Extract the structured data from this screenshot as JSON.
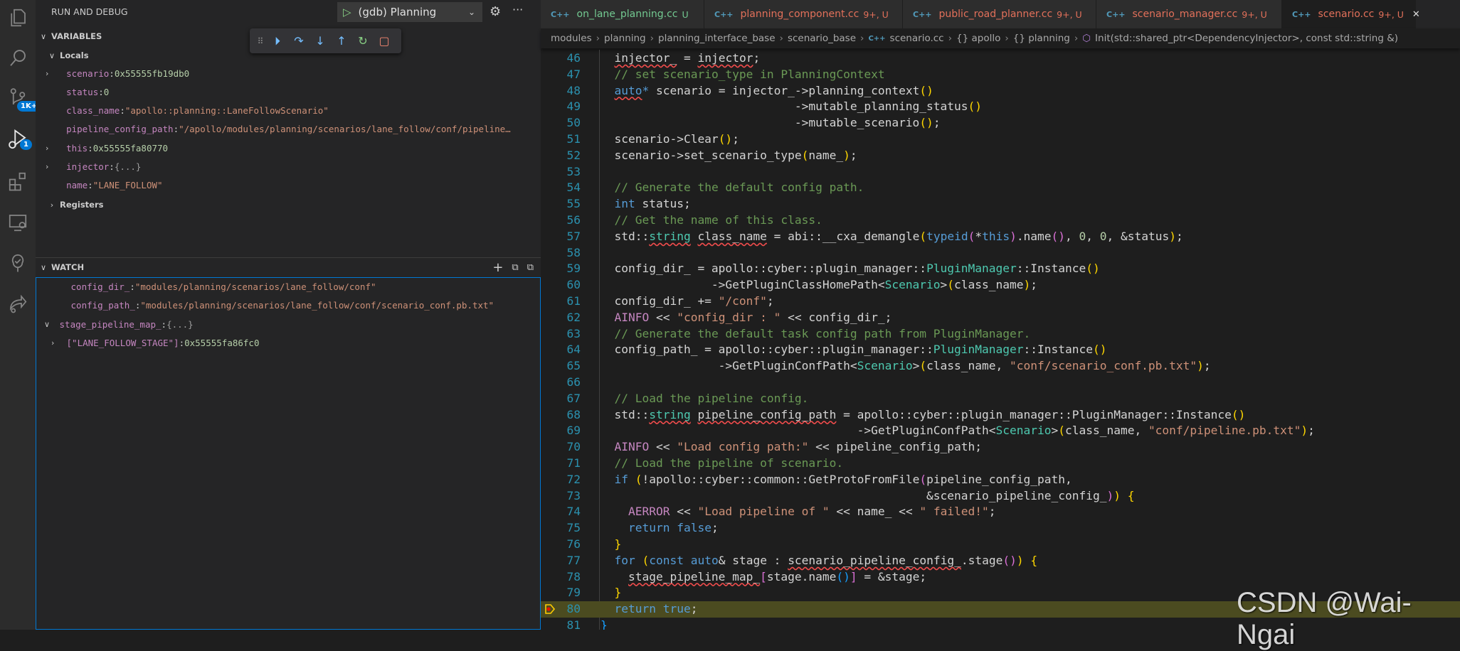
{
  "sidebar": {
    "title": "RUN AND DEBUG",
    "launch_config": "(gdb) Planning",
    "variables_header": "VARIABLES",
    "locals_label": "Locals",
    "locals": [
      {
        "name": "scenario",
        "value": "0x55555fb19db0",
        "kind": "hex",
        "expandable": true
      },
      {
        "name": "status",
        "value": "0",
        "kind": "hex",
        "expandable": false
      },
      {
        "name": "class_name",
        "value": "\"apollo::planning::LaneFollowScenario\"",
        "kind": "str",
        "expandable": false
      },
      {
        "name": "pipeline_config_path",
        "value": "\"/apollo/modules/planning/scenarios/lane_follow/conf/pipeline…",
        "kind": "str",
        "expandable": false
      },
      {
        "name": "this",
        "value": "0x55555fa80770",
        "kind": "hex",
        "expandable": true
      },
      {
        "name": "injector",
        "value": "{...}",
        "kind": "obj",
        "expandable": true
      },
      {
        "name": "name",
        "value": "\"LANE_FOLLOW\"",
        "kind": "str",
        "expandable": false
      }
    ],
    "registers_label": "Registers",
    "watch_header": "WATCH",
    "watch": [
      {
        "name": "config_dir_",
        "value": "\"modules/planning/scenarios/lane_follow/conf\"",
        "kind": "str",
        "indent": 1,
        "twisty": ""
      },
      {
        "name": "config_path_",
        "value": "\"modules/planning/scenarios/lane_follow/conf/scenario_conf.pb.txt\"",
        "kind": "str",
        "indent": 1,
        "twisty": ""
      },
      {
        "name": "stage_pipeline_map_",
        "value": "{...}",
        "kind": "obj",
        "indent": 0,
        "twisty": "expanded"
      },
      {
        "name": "[\"LANE_FOLLOW_STAGE\"]",
        "value": "0x55555fa86fc0",
        "kind": "hex",
        "indent": 2,
        "twisty": "collapsed"
      }
    ]
  },
  "activity_badges": {
    "scm": "1K+",
    "debug": "1"
  },
  "tabs": [
    {
      "label": "on_lane_planning.cc",
      "status": "U",
      "color": "#73c991",
      "active": false
    },
    {
      "label": "planning_component.cc",
      "status": "9+, U",
      "color": "#e2705a",
      "active": false
    },
    {
      "label": "public_road_planner.cc",
      "status": "9+, U",
      "color": "#e2705a",
      "active": false
    },
    {
      "label": "scenario_manager.cc",
      "status": "9+, U",
      "color": "#e2705a",
      "active": false
    },
    {
      "label": "scenario.cc",
      "status": "9+, U",
      "color": "#e2705a",
      "active": true
    }
  ],
  "tab_icon": "C++",
  "breadcrumbs": [
    "modules",
    "planning",
    "planning_interface_base",
    "scenario_base",
    "scenario.cc",
    "{} apollo",
    "{} planning",
    "Init(std::shared_ptr<DependencyInjector>, const std::string &)"
  ],
  "current_line": 80,
  "code_lines": [
    {
      "n": 46,
      "t": [
        [
          "o",
          "  "
        ],
        [
          "oe",
          "injector_"
        ],
        [
          "o",
          " = "
        ],
        [
          "oe",
          "injector"
        ],
        [
          "o",
          ";"
        ]
      ]
    },
    {
      "n": 47,
      "t": [
        [
          "o",
          "  "
        ],
        [
          "c",
          "// set scenario_type in PlanningContext"
        ]
      ]
    },
    {
      "n": 48,
      "t": [
        [
          "o",
          "  "
        ],
        [
          "ke",
          "auto"
        ],
        [
          "k",
          "*"
        ],
        [
          "o",
          " scenario = injector_->planning_context"
        ],
        [
          "p",
          "()"
        ]
      ]
    },
    {
      "n": 49,
      "t": [
        [
          "o",
          "                            ->mutable_planning_status"
        ],
        [
          "p",
          "()"
        ]
      ]
    },
    {
      "n": 50,
      "t": [
        [
          "o",
          "                            ->mutable_scenario"
        ],
        [
          "p",
          "()"
        ],
        [
          "o",
          ";"
        ]
      ]
    },
    {
      "n": 51,
      "t": [
        [
          "o",
          "  scenario->Clear"
        ],
        [
          "p",
          "()"
        ],
        [
          "o",
          ";"
        ]
      ]
    },
    {
      "n": 52,
      "t": [
        [
          "o",
          "  scenario->set_scenario_type"
        ],
        [
          "p",
          "("
        ],
        [
          "o",
          "name_"
        ],
        [
          "p",
          ")"
        ],
        [
          "o",
          ";"
        ]
      ]
    },
    {
      "n": 53,
      "t": []
    },
    {
      "n": 54,
      "t": [
        [
          "o",
          "  "
        ],
        [
          "c",
          "// Generate the default config path."
        ]
      ]
    },
    {
      "n": 55,
      "t": [
        [
          "o",
          "  "
        ],
        [
          "k",
          "int"
        ],
        [
          "o",
          " status;"
        ]
      ]
    },
    {
      "n": 56,
      "t": [
        [
          "o",
          "  "
        ],
        [
          "c",
          "// Get the name of this class."
        ]
      ]
    },
    {
      "n": 57,
      "t": [
        [
          "o",
          "  std::"
        ],
        [
          "te",
          "string"
        ],
        [
          "o",
          " "
        ],
        [
          "oe",
          "class_name"
        ],
        [
          "o",
          " = abi::__cxa_demangle"
        ],
        [
          "p",
          "("
        ],
        [
          "k",
          "typeid"
        ],
        [
          "p2",
          "("
        ],
        [
          "o",
          "*"
        ],
        [
          "k",
          "this"
        ],
        [
          "p2",
          ")"
        ],
        [
          "o",
          ".name"
        ],
        [
          "p2",
          "()"
        ],
        [
          "o",
          ", "
        ],
        [
          "n",
          "0"
        ],
        [
          "o",
          ", "
        ],
        [
          "n",
          "0"
        ],
        [
          "o",
          ", &status"
        ],
        [
          "p",
          ")"
        ],
        [
          "o",
          ";"
        ]
      ]
    },
    {
      "n": 58,
      "t": []
    },
    {
      "n": 59,
      "t": [
        [
          "o",
          "  config_dir_ = apollo::cyber::plugin_manager::"
        ],
        [
          "t",
          "PluginManager"
        ],
        [
          "o",
          "::Instance"
        ],
        [
          "p",
          "()"
        ]
      ]
    },
    {
      "n": 60,
      "t": [
        [
          "o",
          "                ->GetPluginClassHomePath<"
        ],
        [
          "t",
          "Scenario"
        ],
        [
          "o",
          ">"
        ],
        [
          "p",
          "("
        ],
        [
          "o",
          "class_name"
        ],
        [
          "p",
          ")"
        ],
        [
          "o",
          ";"
        ]
      ]
    },
    {
      "n": 61,
      "t": [
        [
          "o",
          "  config_dir_ += "
        ],
        [
          "s",
          "\"/conf\""
        ],
        [
          "o",
          ";"
        ]
      ]
    },
    {
      "n": 62,
      "t": [
        [
          "o",
          "  "
        ],
        [
          "m",
          "AINFO"
        ],
        [
          "o",
          " << "
        ],
        [
          "s",
          "\"config_dir : \""
        ],
        [
          "o",
          " << config_dir_;"
        ]
      ]
    },
    {
      "n": 63,
      "t": [
        [
          "o",
          "  "
        ],
        [
          "c",
          "// Generate the default task config path from PluginManager."
        ]
      ]
    },
    {
      "n": 64,
      "t": [
        [
          "o",
          "  config_path_ = apollo::cyber::plugin_manager::"
        ],
        [
          "t",
          "PluginManager"
        ],
        [
          "o",
          "::Instance"
        ],
        [
          "p",
          "()"
        ]
      ]
    },
    {
      "n": 65,
      "t": [
        [
          "o",
          "                 ->GetPluginConfPath<"
        ],
        [
          "t",
          "Scenario"
        ],
        [
          "o",
          ">"
        ],
        [
          "p",
          "("
        ],
        [
          "o",
          "class_name, "
        ],
        [
          "s",
          "\"conf/scenario_conf.pb.txt\""
        ],
        [
          "p",
          ")"
        ],
        [
          "o",
          ";"
        ]
      ]
    },
    {
      "n": 66,
      "t": []
    },
    {
      "n": 67,
      "t": [
        [
          "o",
          "  "
        ],
        [
          "c",
          "// Load the pipeline config."
        ]
      ]
    },
    {
      "n": 68,
      "t": [
        [
          "o",
          "  std::"
        ],
        [
          "te",
          "string"
        ],
        [
          "o",
          " "
        ],
        [
          "oe",
          "pipeline_config_path"
        ],
        [
          "o",
          " = apollo::cyber::plugin_manager::PluginManager::Instance"
        ],
        [
          "p",
          "()"
        ]
      ]
    },
    {
      "n": 69,
      "t": [
        [
          "o",
          "                                     ->GetPluginConfPath<"
        ],
        [
          "t",
          "Scenario"
        ],
        [
          "o",
          ">"
        ],
        [
          "p",
          "("
        ],
        [
          "o",
          "class_name, "
        ],
        [
          "s",
          "\"conf/pipeline.pb.txt\""
        ],
        [
          "p",
          ")"
        ],
        [
          "o",
          ";"
        ]
      ]
    },
    {
      "n": 70,
      "t": [
        [
          "o",
          "  "
        ],
        [
          "m",
          "AINFO"
        ],
        [
          "o",
          " << "
        ],
        [
          "s",
          "\"Load config path:\""
        ],
        [
          "o",
          " << pipeline_config_path;"
        ]
      ]
    },
    {
      "n": 71,
      "t": [
        [
          "o",
          "  "
        ],
        [
          "c",
          "// Load the pipeline of scenario."
        ]
      ]
    },
    {
      "n": 72,
      "t": [
        [
          "o",
          "  "
        ],
        [
          "k",
          "if"
        ],
        [
          "o",
          " "
        ],
        [
          "p",
          "("
        ],
        [
          "o",
          "!apollo::cyber::common::GetProtoFromFile"
        ],
        [
          "p2",
          "("
        ],
        [
          "o",
          "pipeline_config_path,"
        ]
      ]
    },
    {
      "n": 73,
      "t": [
        [
          "o",
          "                                               &scenario_pipeline_config_"
        ],
        [
          "p2",
          ")"
        ],
        [
          "p",
          ")"
        ],
        [
          "o",
          " "
        ],
        [
          "p",
          "{"
        ]
      ]
    },
    {
      "n": 74,
      "t": [
        [
          "o",
          "    "
        ],
        [
          "m",
          "AERROR"
        ],
        [
          "o",
          " << "
        ],
        [
          "s",
          "\"Load pipeline of \""
        ],
        [
          "o",
          " << name_ << "
        ],
        [
          "s",
          "\" failed!\""
        ],
        [
          "o",
          ";"
        ]
      ]
    },
    {
      "n": 75,
      "t": [
        [
          "o",
          "    "
        ],
        [
          "k",
          "return"
        ],
        [
          "o",
          " "
        ],
        [
          "k",
          "false"
        ],
        [
          "o",
          ";"
        ]
      ]
    },
    {
      "n": 76,
      "t": [
        [
          "o",
          "  "
        ],
        [
          "p",
          "}"
        ]
      ]
    },
    {
      "n": 77,
      "t": [
        [
          "o",
          "  "
        ],
        [
          "k",
          "for"
        ],
        [
          "o",
          " "
        ],
        [
          "p",
          "("
        ],
        [
          "k",
          "const"
        ],
        [
          "o",
          " "
        ],
        [
          "k",
          "auto"
        ],
        [
          "o",
          "& stage : "
        ],
        [
          "oe",
          "scenario_pipeline_config_"
        ],
        [
          "o",
          ".stage"
        ],
        [
          "p2",
          "()"
        ],
        [
          "p",
          ")"
        ],
        [
          "o",
          " "
        ],
        [
          "p",
          "{"
        ]
      ]
    },
    {
      "n": 78,
      "t": [
        [
          "o",
          "    "
        ],
        [
          "oe",
          "stage_pipeline_map_"
        ],
        [
          "p2",
          "["
        ],
        [
          "o",
          "stage.name"
        ],
        [
          "p3",
          "()"
        ],
        [
          "p2",
          "]"
        ],
        [
          "o",
          " = &stage;"
        ]
      ]
    },
    {
      "n": 79,
      "t": [
        [
          "o",
          "  "
        ],
        [
          "p",
          "}"
        ]
      ]
    },
    {
      "n": 80,
      "t": [
        [
          "o",
          "  "
        ],
        [
          "k",
          "return"
        ],
        [
          "o",
          " "
        ],
        [
          "k",
          "true"
        ],
        [
          "o",
          ";"
        ]
      ]
    },
    {
      "n": 81,
      "t": [
        [
          "p3",
          "}"
        ]
      ]
    }
  ],
  "watermark": "CSDN @Wai-Ngai"
}
